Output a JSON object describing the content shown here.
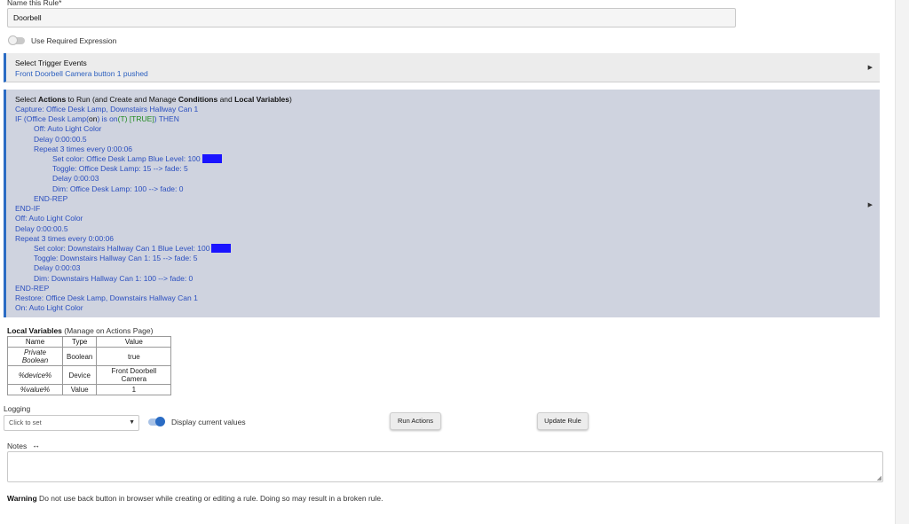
{
  "rule": {
    "name_label": "Name this Rule*",
    "name_value": "Doorbell",
    "required_expression_label": "Use Required Expression"
  },
  "trigger": {
    "title": "Select Trigger Events",
    "value": "Front Doorbell Camera button 1 pushed"
  },
  "actions": {
    "title_pre": "Select ",
    "title_b1": "Actions",
    "title_mid1": " to Run (and Create and Manage ",
    "title_b2": "Conditions",
    "title_mid2": " and ",
    "title_b3": "Local Variables",
    "title_post": ")",
    "lines": {
      "l1": "Capture: Office Desk Lamp, Downstairs Hallway Can 1",
      "l2a": "IF (Office Desk Lamp(",
      "l2b": "on",
      "l2c": ") is on",
      "l2d": "(T) [TRUE]",
      "l2e": ") THEN",
      "l3": "Off: Auto Light Color",
      "l4": "Delay 0:00:00.5",
      "l5": "Repeat 3 times every 0:00:06",
      "l6": "Set color: Office Desk Lamp  Blue  Level: 100",
      "l7": "Toggle: Office Desk Lamp: 15 --> fade: 5",
      "l8": "Delay 0:00:03",
      "l9": "Dim: Office Desk Lamp: 100 --> fade: 0",
      "l10": "END-REP",
      "l11": "END-IF",
      "l12": "Off: Auto Light Color",
      "l13": "Delay 0:00:00.5",
      "l14": "Repeat 3 times every 0:00:06",
      "l15": "Set color: Downstairs Hallway Can 1  Blue  Level: 100",
      "l16": "Toggle: Downstairs Hallway Can 1: 15 --> fade: 5",
      "l17": "Delay 0:00:03",
      "l18": "Dim: Downstairs Hallway Can 1: 100 --> fade: 0",
      "l19": "END-REP",
      "l20": "Restore: Office Desk Lamp, Downstairs Hallway Can 1",
      "l21": "On: Auto Light Color"
    },
    "swatch_color": "#1a14ff"
  },
  "local_variables": {
    "title_b": "Local Variables",
    "title_rest": " (Manage on Actions Page)",
    "headers": [
      "Name",
      "Type",
      "Value"
    ],
    "rows": [
      [
        "Private Boolean",
        "Boolean",
        "true"
      ],
      [
        "%device%",
        "Device",
        "Front Doorbell Camera"
      ],
      [
        "%value%",
        "Value",
        "1"
      ]
    ]
  },
  "logging": {
    "label": "Logging",
    "placeholder": "Click to set",
    "display_label": "Display current values"
  },
  "buttons": {
    "run": "Run Actions",
    "update": "Update Rule"
  },
  "notes": {
    "label": "Notes",
    "expand_glyph": "↔"
  },
  "warning": {
    "bold": "Warning",
    "text": " Do not use back button in browser while creating or editing a rule. Doing so may result in a broken rule."
  },
  "colors": {
    "accent": "#2b6cc4",
    "link": "#2b4fbf",
    "true_green": "#1f8a1f"
  }
}
